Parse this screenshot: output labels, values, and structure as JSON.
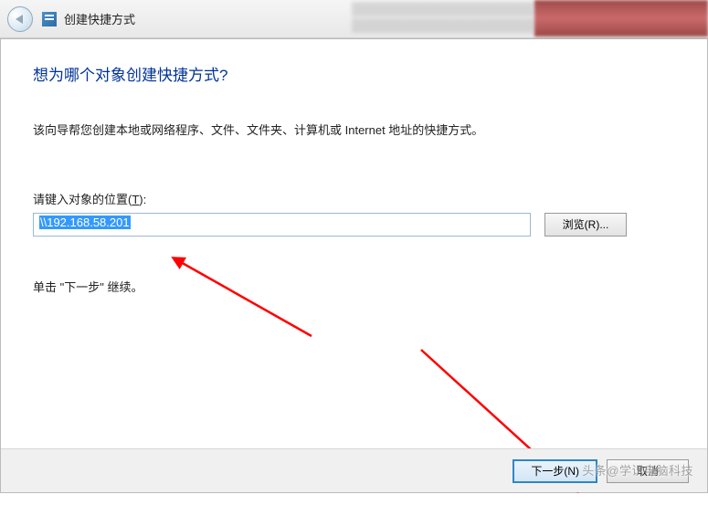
{
  "titlebar": {
    "title": "创建快捷方式"
  },
  "wizard": {
    "heading": "想为哪个对象创建快捷方式?",
    "description": "该向导帮您创建本地或网络程序、文件、文件夹、计算机或 Internet 地址的快捷方式。",
    "location_label_prefix": "请键入对象的位置(",
    "location_label_key": "T",
    "location_label_suffix": "):",
    "location_value": "\\\\192.168.58.201",
    "browse_label": "浏览(R)...",
    "continue_hint": "单击 \"下一步\" 继续。"
  },
  "buttons": {
    "next": "下一步(N)",
    "cancel": "取消"
  },
  "watermark": "头条@学识电脑科技"
}
